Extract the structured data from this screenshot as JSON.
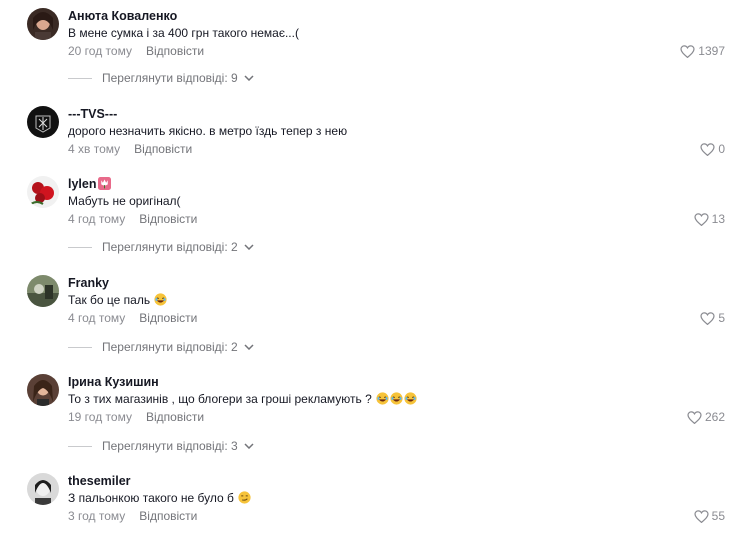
{
  "comments": [
    {
      "username": "Анюта Коваленко",
      "text": "В мене сумка і за 400 грн такого немає...(",
      "time": "20 год тому",
      "reply_label": "Відповісти",
      "likes": "1397",
      "view_replies": "Переглянути відповіді: 9"
    },
    {
      "username": "---TVS---",
      "text": "дорого незначить якісно. в метро їздь тепер з нею",
      "time": "4 хв тому",
      "reply_label": "Відповісти",
      "likes": "0"
    },
    {
      "username": "lylen",
      "username_emoji": "tulip-emoji",
      "text": "Мабуть не оригінал(",
      "time": "4 год тому",
      "reply_label": "Відповісти",
      "likes": "13",
      "view_replies": "Переглянути відповіді: 2"
    },
    {
      "username": "Franky",
      "text": "Так бо це паль",
      "text_emoji": [
        "laughing-emoji"
      ],
      "time": "4 год тому",
      "reply_label": "Відповісти",
      "likes": "5",
      "view_replies": "Переглянути відповіді: 2"
    },
    {
      "username": "Ірина Кузишин",
      "text": "То з тих магазинів , що блогери за гроші рекламують ?",
      "text_emoji": [
        "laughing-emoji",
        "laughing-emoji",
        "laughing-emoji"
      ],
      "time": "19 год тому",
      "reply_label": "Відповісти",
      "likes": "262",
      "view_replies": "Переглянути відповіді: 3"
    },
    {
      "username": "thesemiler",
      "text": "З пальонкою такого не було б",
      "text_emoji": [
        "smirk-emoji"
      ],
      "time": "3 год тому",
      "reply_label": "Відповісти",
      "likes": "55"
    }
  ],
  "colors": {
    "primary_text": "#161823",
    "secondary_text": "#8a8b91",
    "reply_text": "#737479",
    "divider": "#c9cacd"
  },
  "icons": {
    "like": "heart-outline-icon",
    "expand": "chevron-down-icon"
  }
}
